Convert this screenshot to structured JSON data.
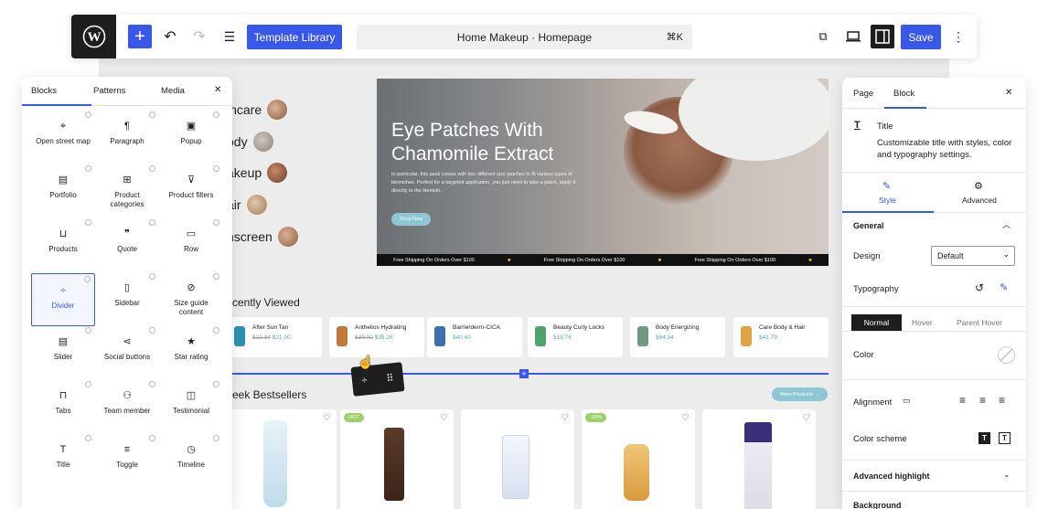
{
  "topbar": {
    "add_label": "+",
    "template_library": "Template Library",
    "doc_title": "Home Makeup · Homepage",
    "shortcut": "⌘K",
    "save": "Save",
    "icons": [
      "wordpress-icon",
      "undo-icon",
      "redo-icon",
      "list-view-icon",
      "external-link-icon",
      "desktop-preview-icon",
      "sidebar-toggle-icon",
      "more-vertical-icon"
    ]
  },
  "left_panel": {
    "tabs": [
      "Blocks",
      "Patterns",
      "Media"
    ],
    "close": "✕",
    "blocks": [
      {
        "label": "Open street map",
        "icon": "map-icon"
      },
      {
        "label": "Paragraph",
        "icon": "paragraph-icon"
      },
      {
        "label": "Popup",
        "icon": "popup-icon"
      },
      {
        "label": "Portfolio",
        "icon": "portfolio-icon"
      },
      {
        "label": "Product categories",
        "icon": "grid-icon"
      },
      {
        "label": "Product filters",
        "icon": "filter-icon"
      },
      {
        "label": "Products",
        "icon": "cart-icon"
      },
      {
        "label": "Quote",
        "icon": "quote-icon"
      },
      {
        "label": "Row",
        "icon": "row-icon"
      },
      {
        "label": "Divider",
        "icon": "divider-icon"
      },
      {
        "label": "Sidebar",
        "icon": "sidebar-icon"
      },
      {
        "label": "Size guide content",
        "icon": "ruler-icon"
      },
      {
        "label": "Slider",
        "icon": "slider-icon"
      },
      {
        "label": "Social buttons",
        "icon": "share-icon"
      },
      {
        "label": "Star rating",
        "icon": "star-icon"
      },
      {
        "label": "Tabs",
        "icon": "tabs-icon"
      },
      {
        "label": "Team member",
        "icon": "team-icon"
      },
      {
        "label": "Testimonial",
        "icon": "testimonial-icon"
      },
      {
        "label": "Title",
        "icon": "title-icon"
      },
      {
        "label": "Toggle",
        "icon": "toggle-icon"
      },
      {
        "label": "Timeline",
        "icon": "timeline-icon"
      }
    ],
    "selected": "Divider"
  },
  "canvas": {
    "categories": [
      "incare",
      "ody",
      "akeup",
      "air",
      "nscreen"
    ],
    "hero": {
      "title_line1": "Eye Patches With",
      "title_line2": "Chamomile Extract",
      "body": "In particular, this pack comes with two different size patches to fit various types of blemishes. Perfect for a targeted application, you just need to take a patch, apply it directly to the blemish.",
      "button": "Shop Now",
      "band": [
        "Free Shipping On Orders Over $100",
        "Free Shipping On Orders Over $100",
        "Free Shipping On Orders Over $100"
      ]
    },
    "recently_viewed": {
      "heading": "cently Viewed",
      "items": [
        {
          "name": "After Sun Tan",
          "old": "$22.34",
          "price": "$21.00",
          "color": "#2d8fb6"
        },
        {
          "name": "Anthelios Hydrating",
          "old": "",
          "price": "$35.26",
          "color": "#c27a3a"
        },
        {
          "name": "Barrierderm-CICA",
          "old": "",
          "price": "$40.40",
          "color": "#3b6fb0"
        },
        {
          "name": "Beauty Curly Locks",
          "old": "",
          "price": "$19.76",
          "color": "#4ca36b"
        },
        {
          "name": "Body Energizing",
          "old": "",
          "price": "$64.34",
          "color": "#6e9a7e"
        },
        {
          "name": "Care Body & Hair",
          "old": "",
          "price": "$41.79",
          "color": "#e0a244"
        }
      ]
    },
    "bestsellers": {
      "heading": "eek Bestsellers",
      "more": "More Products →",
      "badges": [
        "",
        "HOT",
        "",
        "-20%",
        "",
        ""
      ]
    }
  },
  "right_panel": {
    "tabs": [
      "Page",
      "Block"
    ],
    "close": "✕",
    "block_name": "Title",
    "block_desc": "Customizable title with styles, color and typography settings.",
    "subtabs": [
      "Style",
      "Advanced"
    ],
    "general": "General",
    "design_label": "Design",
    "design_value": "Default",
    "typography": "Typography",
    "state_tabs": [
      "Normal",
      "Hover",
      "Parent Hover"
    ],
    "color": "Color",
    "alignment": "Alignment",
    "color_scheme": "Color scheme",
    "advanced_highlight": "Advanced highlight",
    "background": "Background"
  }
}
